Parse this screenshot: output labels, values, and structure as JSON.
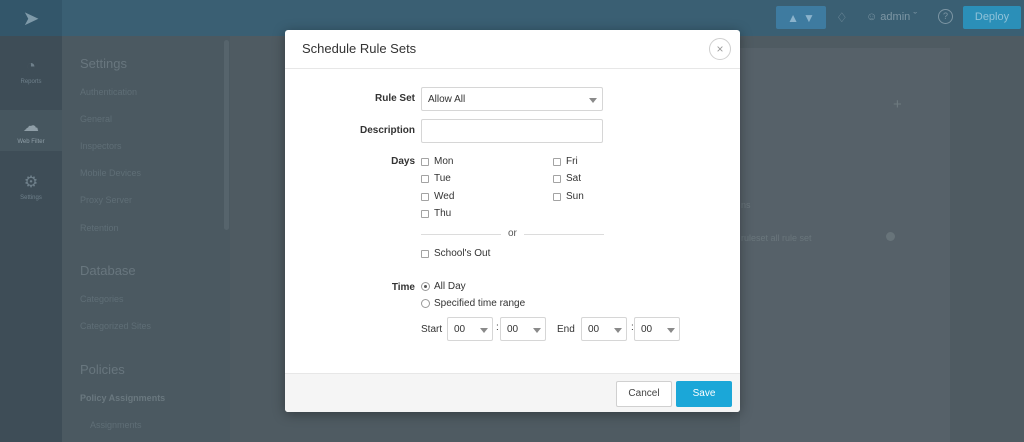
{
  "background": {
    "topbar": {
      "user": "admin",
      "deploy_label": "Deploy"
    },
    "leftnav": [
      {
        "label": "Reports",
        "icon": "chart-icon"
      },
      {
        "label": "Web Filter",
        "icon": "cloud-icon"
      },
      {
        "label": "Settings",
        "icon": "gear-icon"
      }
    ],
    "settings": {
      "sections": [
        {
          "title": "Settings",
          "items": [
            "Authentication",
            "General",
            "Inspectors",
            "Mobile Devices",
            "Proxy Server",
            "Retention"
          ]
        },
        {
          "title": "Database",
          "items": [
            "Categories",
            "Categorized Sites"
          ]
        },
        {
          "title": "Policies",
          "items": [
            "Policy Assignments",
            "Assignments"
          ]
        }
      ]
    },
    "content": {
      "text1": "ns",
      "text2": "ruleset all rule set"
    }
  },
  "modal": {
    "title": "Schedule Rule Sets",
    "close_glyph": "×",
    "rule_set": {
      "label": "Rule Set",
      "value": "Allow All"
    },
    "description": {
      "label": "Description",
      "value": "",
      "placeholder": ""
    },
    "days": {
      "label": "Days",
      "left": [
        "Mon",
        "Tue",
        "Wed",
        "Thu"
      ],
      "right": [
        "Fri",
        "Sat",
        "Sun"
      ],
      "or_text": "or",
      "schools_out": "School's Out"
    },
    "time": {
      "label": "Time",
      "options": [
        {
          "label": "All Day",
          "selected": true
        },
        {
          "label": "Specified time range",
          "selected": false
        }
      ],
      "start_label": "Start",
      "end_label": "End",
      "start_hour": "00",
      "start_min": "00",
      "end_hour": "00",
      "end_min": "00",
      "separator": ":"
    },
    "footer": {
      "cancel_label": "Cancel",
      "save_label": "Save"
    }
  },
  "colors": {
    "accent": "#1ba7d8",
    "topbar": "#3a5f73",
    "overlay": "#4d5a64"
  }
}
